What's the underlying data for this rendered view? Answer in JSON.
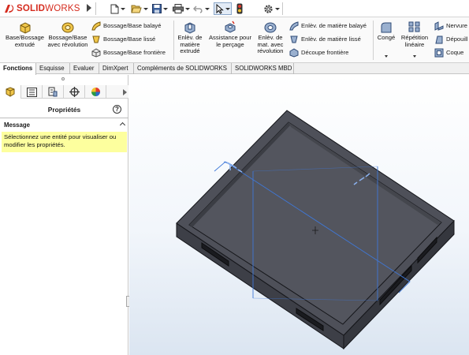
{
  "app": {
    "brand_ds": "3S",
    "brand_solid": "SOLID",
    "brand_works": "WORKS"
  },
  "quick_access": [
    "new-icon",
    "open-icon",
    "save-icon",
    "print-icon",
    "undo-icon",
    "select-icon",
    "rebuild-icon",
    "options-icon"
  ],
  "command_manager": {
    "extruded_boss": "Base/Bossage extrudé",
    "revolved_boss": "Bossage/Base avec révolution",
    "swept_boss": "Bossage/Base balayé",
    "lofted_boss": "Bossage/Base lissé",
    "boundary_boss": "Bossage/Base frontière",
    "extruded_cut": "Enlèv. de matière extrudé",
    "hole_wizard": "Assistance pour le perçage",
    "revolved_cut": "Enlèv. de mat. avec révolution",
    "swept_cut": "Enlèv. de matière balayé",
    "lofted_cut": "Enlèv. de matière lissé",
    "boundary_cut": "Découpe frontière",
    "fillet": "Congé",
    "linear_pattern": "Répétition linéaire",
    "rib": "Nervure",
    "draft": "Dépouill",
    "shell": "Coque"
  },
  "tabs": [
    {
      "label": "Fonctions",
      "active": true
    },
    {
      "label": "Esquisse",
      "active": false
    },
    {
      "label": "Evaluer",
      "active": false
    },
    {
      "label": "DimXpert",
      "active": false
    },
    {
      "label": "Compléments de SOLIDWORKS",
      "active": false
    },
    {
      "label": "SOLIDWORKS MBD",
      "active": false
    }
  ],
  "panel": {
    "title": "Propriétés",
    "help": "?",
    "message_header": "Message",
    "message_text": "Sélectionnez une entité pour visualiser ou modifier les propriétés."
  },
  "colors": {
    "brand_red": "#d52b1e",
    "model_top": "#4e5059",
    "model_side": "#3d3f47",
    "model_edge": "#15161a",
    "reference_plane": "#3f78d8",
    "message_bg": "#fdff9e"
  }
}
